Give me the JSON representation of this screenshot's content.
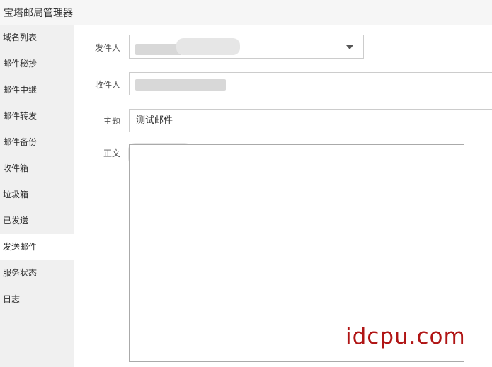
{
  "app": {
    "title": "宝塔邮局管理器"
  },
  "sidebar": {
    "items": [
      {
        "label": "域名列表"
      },
      {
        "label": "邮件秘抄"
      },
      {
        "label": "邮件中继"
      },
      {
        "label": "邮件转发"
      },
      {
        "label": "邮件备份"
      },
      {
        "label": "收件箱"
      },
      {
        "label": "垃圾箱"
      },
      {
        "label": "已发送"
      },
      {
        "label": "发送邮件",
        "active": true
      },
      {
        "label": "服务状态"
      },
      {
        "label": "日志"
      }
    ]
  },
  "form": {
    "sender_label": "发件人",
    "recipient_label": "收件人",
    "subject_label": "主题",
    "subject_value": "测试邮件",
    "body_label": "正文"
  },
  "watermark": "idcpu.com",
  "colors": {
    "sidebar_bg": "#f0f0f0",
    "active_item_bg": "#ffffff",
    "watermark": "#b01515"
  }
}
